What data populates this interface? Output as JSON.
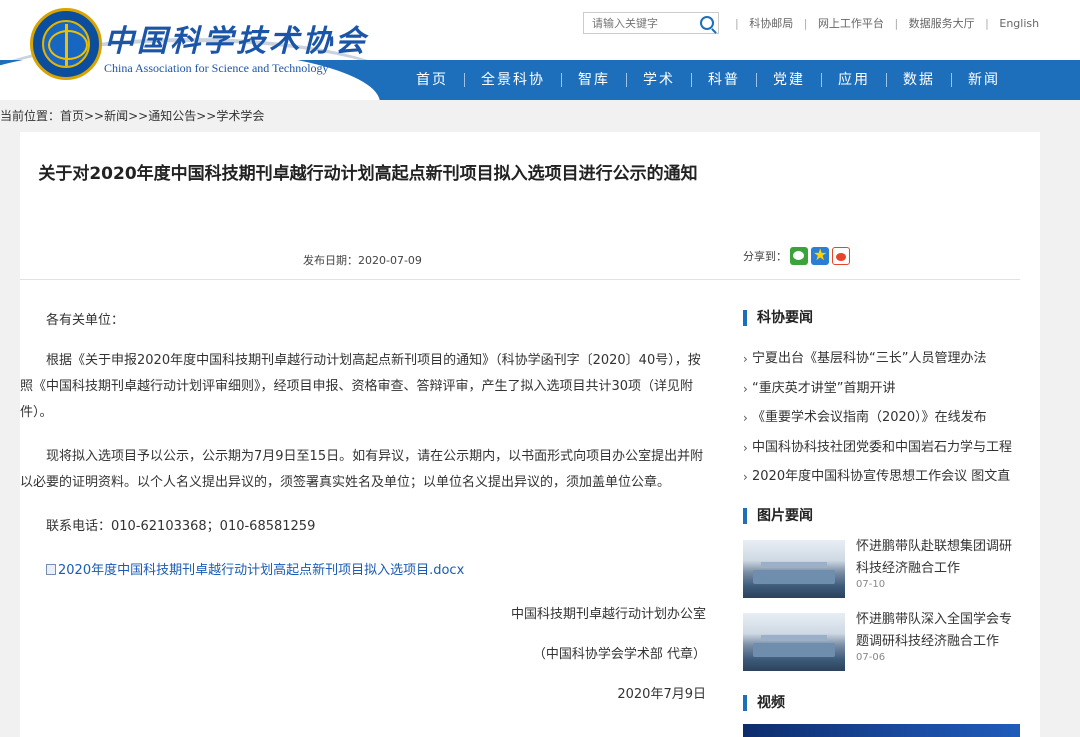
{
  "header": {
    "logo_cn": "中国科学技术协会",
    "logo_en": "China Association for Science and Technology",
    "search_placeholder": "请输入关键字",
    "top_links": [
      "科协邮局",
      "网上工作平台",
      "数据服务大厅",
      "English"
    ],
    "nav": [
      "首页",
      "全景科协",
      "智库",
      "学术",
      "科普",
      "党建",
      "应用",
      "数据",
      "新闻"
    ]
  },
  "breadcrumb": "当前位置：首页>>新闻>>通知公告>>学术学会",
  "article": {
    "title": "关于对2020年度中国科技期刊卓越行动计划高起点新刊项目拟入选项目进行公示的通知",
    "date_label": "发布日期：2020-07-09",
    "share_label": "分享到：",
    "salutation": "各有关单位：",
    "para1": "根据《关于申报2020年度中国科技期刊卓越行动计划高起点新刊项目的通知》（科协学函刊字〔2020〕40号），按照《中国科技期刊卓越行动计划评审细则》，经项目申报、资格审查、答辩评审，产生了拟入选项目共计30项（详见附件）。",
    "para2": "现将拟入选项目予以公示，公示期为7月9日至15日。如有异议，请在公示期内，以书面形式向项目办公室提出并附以必要的证明资料。以个人名义提出异议的，须签署真实姓名及单位；以单位名义提出异议的，须加盖单位公章。",
    "contact": "联系电话：010-62103368；010-68581259",
    "attachment": "2020年度中国科技期刊卓越行动计划高起点新刊项目拟入选项目.docx",
    "sign_office": "中国科技期刊卓越行动计划办公室",
    "sign_seal": "（中国科协学会学术部 代章）",
    "sign_date": "2020年7月9日"
  },
  "sidebar": {
    "news_title": "科协要闻",
    "news": [
      "宁夏出台《基层科协“三长”人员管理办法",
      "“重庆英才讲堂”首期开讲",
      "《重要学术会议指南（2020）》在线发布",
      "中国科协科技社团党委和中国岩石力学与工程",
      "2020年度中国科协宣传思想工作会议 图文直"
    ],
    "pic_title": "图片要闻",
    "pics": [
      {
        "title": "怀进鹏带队赴联想集团调研科技经济融合工作",
        "date": "07-10"
      },
      {
        "title": "怀进鹏带队深入全国学会专题调研科技经济融合工作",
        "date": "07-06"
      }
    ],
    "video_title": "视频"
  },
  "colors": {
    "brand_blue": "#1d6fbc",
    "link": "#1a5bb5"
  }
}
